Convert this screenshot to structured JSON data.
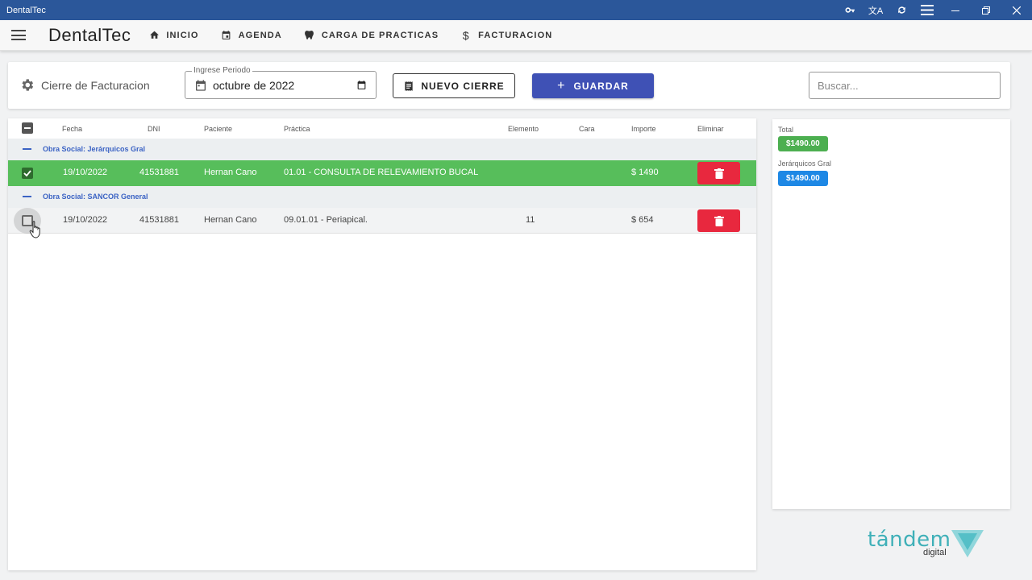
{
  "window": {
    "title": "DentalTec",
    "icons": [
      "key-icon",
      "translate-icon",
      "sync-icon",
      "menu-icon",
      "minimize-icon",
      "restore-icon",
      "close-icon"
    ]
  },
  "appbar": {
    "logo": "DentalTec",
    "nav": [
      {
        "label": "INICIO",
        "icon": "home-icon"
      },
      {
        "label": "AGENDA",
        "icon": "calendar-icon"
      },
      {
        "label": "CARGA DE PRACTICAS",
        "icon": "tooth-icon"
      },
      {
        "label": "FACTURACION",
        "icon": "dollar-icon"
      }
    ]
  },
  "toolbar": {
    "title": "Cierre de Facturacion",
    "period_label": "Ingrese Periodo",
    "period_value": "octubre de 2022",
    "new_label": "NUEVO CIERRE",
    "save_label": "GUARDAR",
    "search_placeholder": "Buscar..."
  },
  "table": {
    "headers": [
      "Fecha",
      "DNI",
      "Paciente",
      "Práctica",
      "Elemento",
      "Cara",
      "Importe",
      "Eliminar"
    ],
    "groups": [
      {
        "label": "Obra Social: Jerárquicos Gral",
        "rows": [
          {
            "fecha": "19/10/2022",
            "dni": "41531881",
            "paciente": "Hernan Cano",
            "practica": "01.01 - CONSULTA DE RELEVAMIENTO BUCAL",
            "elemento": "",
            "cara": "",
            "importe": "$ 1490",
            "checked": true
          }
        ]
      },
      {
        "label": "Obra Social: SANCOR General",
        "rows": [
          {
            "fecha": "19/10/2022",
            "dni": "41531881",
            "paciente": "Hernan Cano",
            "practica": "09.01.01 - Periapical.",
            "elemento": "11",
            "cara": "",
            "importe": "$ 654",
            "checked": false
          }
        ]
      }
    ]
  },
  "totals": {
    "total_label": "Total",
    "total_value": "$1490.00",
    "group_label": "Jerárquicos Gral",
    "group_value": "$1490.00"
  },
  "watermark": {
    "brand": "tándem",
    "sub": "digital"
  },
  "colors": {
    "titlebar": "#2b579a",
    "primary": "#3f51b5",
    "selected_row": "#57be5b",
    "delete": "#e8283e",
    "group_text": "#3b63c4"
  }
}
